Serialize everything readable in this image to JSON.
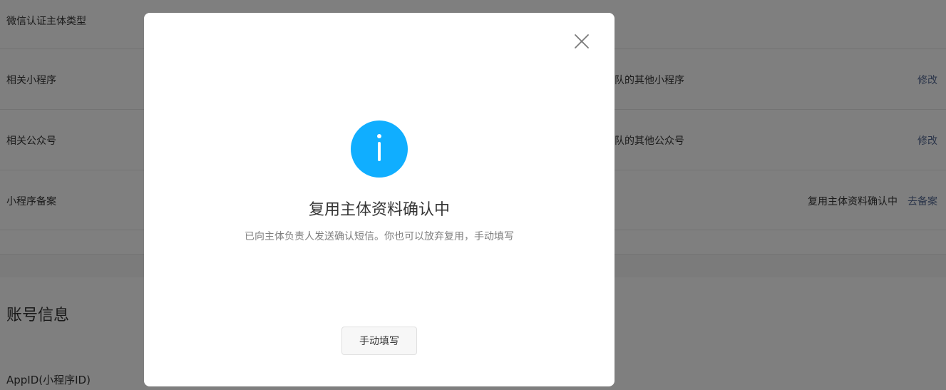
{
  "background": {
    "rows": [
      {
        "label": "微信认证主体类型",
        "value": ""
      },
      {
        "label": "相关小程序",
        "value": "队的其他小程序",
        "action": "修改"
      },
      {
        "label": "相关公众号",
        "value": "队的其他公众号",
        "action": "修改"
      },
      {
        "label": "小程序备案",
        "value": "复用主体资料确认中",
        "action": "去备案"
      }
    ],
    "section_title": "账号信息",
    "appid_label": "AppID(小程序ID)"
  },
  "dialog": {
    "icon": "info-icon",
    "title": "复用主体资料确认中",
    "description": "已向主体负责人发送确认短信。你也可以放弃复用，手动填写",
    "button_label": "手动填写",
    "close_icon": "close-icon"
  },
  "colors": {
    "info_icon": "#10aeff",
    "link": "#576b95",
    "overlay": "rgba(0,0,0,0.5)"
  }
}
